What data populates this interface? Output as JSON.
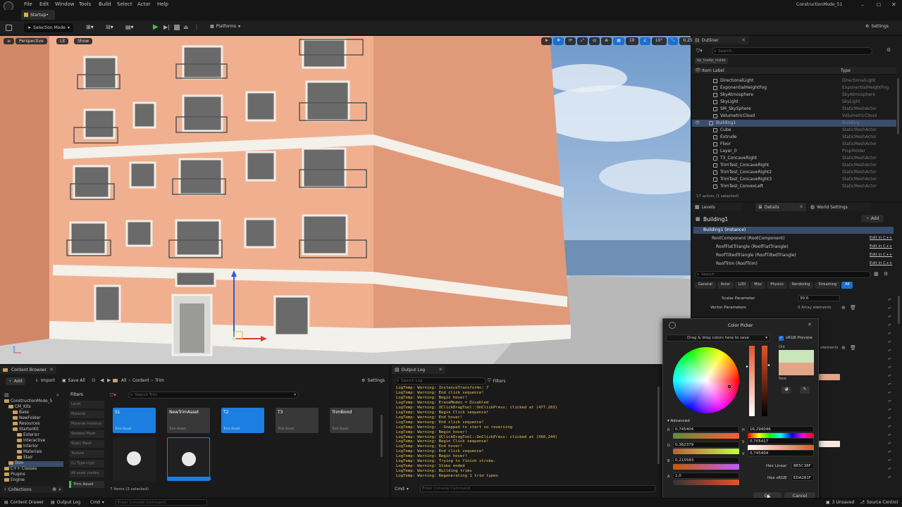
{
  "menubar": {
    "items": [
      "File",
      "Edit",
      "Window",
      "Tools",
      "Build",
      "Select",
      "Actor",
      "Help"
    ],
    "project": "ConstructionMode_51"
  },
  "tabbar": {
    "level_tab": "Startup•"
  },
  "toolbar": {
    "mode": "Selection Mode",
    "platforms": "Platforms",
    "settings": "Settings"
  },
  "viewport": {
    "perspective": "Perspective",
    "lit": "Lit",
    "show": "Show",
    "grid_value": "10",
    "angle_value": "10°",
    "scale_value": "0.25",
    "camera_speed": "4"
  },
  "outliner": {
    "tab": "Outliner",
    "search_placeholder": "Search...",
    "filter_chip": "bp_tvatip_inside",
    "col_label": "Item Label",
    "col_type": "Type",
    "rows": [
      {
        "label": "DirectionalLight",
        "type": "DirectionalLight"
      },
      {
        "label": "ExponentialHeightFog",
        "type": "ExponentialHeightFog"
      },
      {
        "label": "SkyAtmosphere",
        "type": "SkyAtmosphere"
      },
      {
        "label": "SkyLight",
        "type": "SkyLight"
      },
      {
        "label": "SM_SkySphere",
        "type": "StaticMeshActor"
      },
      {
        "label": "VolumetricCloud",
        "type": "VolumetricCloud"
      },
      {
        "label": "Building1",
        "type": "Building"
      },
      {
        "label": "Cube",
        "type": "StaticMeshActor"
      },
      {
        "label": "Extrude",
        "type": "StaticMeshActor"
      },
      {
        "label": "Floor",
        "type": "StaticMeshActor"
      },
      {
        "label": "Layer_0",
        "type": "PropHolder"
      },
      {
        "label": "T3_ConcaveRight",
        "type": "StaticMeshActor"
      },
      {
        "label": "TrimTest_ConcaveRight",
        "type": "StaticMeshActor"
      },
      {
        "label": "TrimTest_ConcaveRight2",
        "type": "StaticMeshActor"
      },
      {
        "label": "TrimTest_ConcaveRight3",
        "type": "StaticMeshActor"
      },
      {
        "label": "TrimTest_ConvexLeft",
        "type": "StaticMeshActor"
      }
    ],
    "footer": "17 actors (1 selected)"
  },
  "details": {
    "tabs": [
      "Levels",
      "Details",
      "World Settings"
    ],
    "actor_name": "Building1",
    "add_label": "Add",
    "components": [
      "Building1 (Instance)",
      "RootComponent (RootComponent)",
      "RoofFlatTriangle (RoofFlatTriangle)",
      "RoofTiltedTriangle (RoofTiltedTriangle)",
      "RoofTrim (RoofTrim)"
    ],
    "edit_in_cpp": "Edit in C++",
    "search_placeholder": "Search",
    "filters": [
      "General",
      "Actor",
      "LOD",
      "Misc",
      "Physics",
      "Rendering",
      "Streaming",
      "All"
    ],
    "scalar_label": "Scalar Parameter",
    "scalar_value": "30.0",
    "vector_label": "Vector Parameters",
    "vector_value": "0 Array elements",
    "elements_label": "elements"
  },
  "color_picker": {
    "title": "Color Picker",
    "drag_hint": "Drag & drop colors here to save",
    "srgb": "sRGB Preview",
    "old": "Old",
    "new": "New",
    "advanced": "Advanced",
    "r_label": "R",
    "r_value": "0,745404",
    "g_label": "G",
    "g_value": "0,362379",
    "b_label": "B",
    "b_value": "0,215583",
    "a_label": "A",
    "a_value": "1,0",
    "h_label": "H",
    "h_value": "16,294046",
    "s_label": "S",
    "s_value": "0,705417",
    "v_label": "V",
    "v_value": "0,745404",
    "hex_linear_label": "Hex Linear",
    "hex_linear": "BE5C38F",
    "hex_srgb_label": "Hex sRGB",
    "hex_srgb": "EDA281F",
    "ok": "OK",
    "cancel": "Cancel",
    "old_color": "#c8e6b8",
    "new_color": "#e3a488"
  },
  "content_browser": {
    "tab": "Content Browser",
    "add": "Add",
    "import": "Import",
    "save_all": "Save All",
    "settings": "Settings",
    "path": [
      "All",
      "Content",
      "Trim"
    ],
    "tree": [
      "ConstructionMode_5",
      "CM_Kits",
      "Bake",
      "NewFolder",
      "Resources",
      "StarterKit",
      "Exterior",
      "Interactive",
      "Interior",
      "Materials",
      "Stair",
      "Trim",
      "C++ Classes",
      "Plugins",
      "Engine"
    ],
    "collections": "Collections",
    "filters_title": "Filters",
    "filters": [
      "Level",
      "Material",
      "Material Instance",
      "Skeletal Mesh",
      "Static Mesh",
      "Texture",
      "(L) Type+(gs)",
      "All asset modes"
    ],
    "trim_asset_filter": "Trim Asset",
    "search_placeholder": "Search Trim",
    "assets": [
      {
        "name": "S1",
        "sub": "Trim Asset"
      },
      {
        "name": "NewTrimAsset",
        "sub": "Trim Asset"
      },
      {
        "name": "T2",
        "sub": "Trim Asset"
      },
      {
        "name": "T3",
        "sub": "Trim Asset"
      },
      {
        "name": "TrimBond",
        "sub": "Trim Asset"
      }
    ],
    "status": "7 items (3 selected)"
  },
  "output_log": {
    "tab": "Output Log",
    "search_placeholder": "Search Log",
    "filters": "Filters",
    "cmd": "Cmd",
    "console_placeholder": "Enter Console Command",
    "lines": [
      "LogTemp: Warning: InstanceTransforms: 7",
      "LogTemp: Warning: End click sequence!",
      "LogTemp: Warning: Begin hover!",
      "LogTemp: Warning: EraseModes = Disabled",
      "LogTemp: Warning: UClickDragTool::OnClickPress: clicked at (477.263)",
      "LogTemp: Warning: Begin Click sequence!",
      "LogTemp: Warning: End hover!",
      "LogTemp: Warning: End click sequence!",
      "LogTemp: Warning: --Snapped to start so reversing",
      "LogTemp: Warning: Begin hover!",
      "LogTemp: Warning: UClickDragTool::OnClickPress: clicked at (560,244)",
      "LogTemp: Warning: Begin Click sequence!",
      "LogTemp: Warning: End hover!",
      "LogTemp: Warning: End click sequence!",
      "LogTemp: Warning: Begin hover!",
      "LogTemp: Warning: Trying to finish stroke.",
      "LogTemp: Warning: Stoke ended",
      "LogTemp: Warning: Building trims",
      "LogTemp: Warning: Regenerating 1 trim types"
    ]
  },
  "statusbar": {
    "content_drawer": "Content Drawer",
    "output_log": "Output Log",
    "cmd": "Cmd",
    "console_placeholder": "Enter Console Command",
    "unsaved": "3 Unsaved",
    "source_control": "Source Control"
  }
}
